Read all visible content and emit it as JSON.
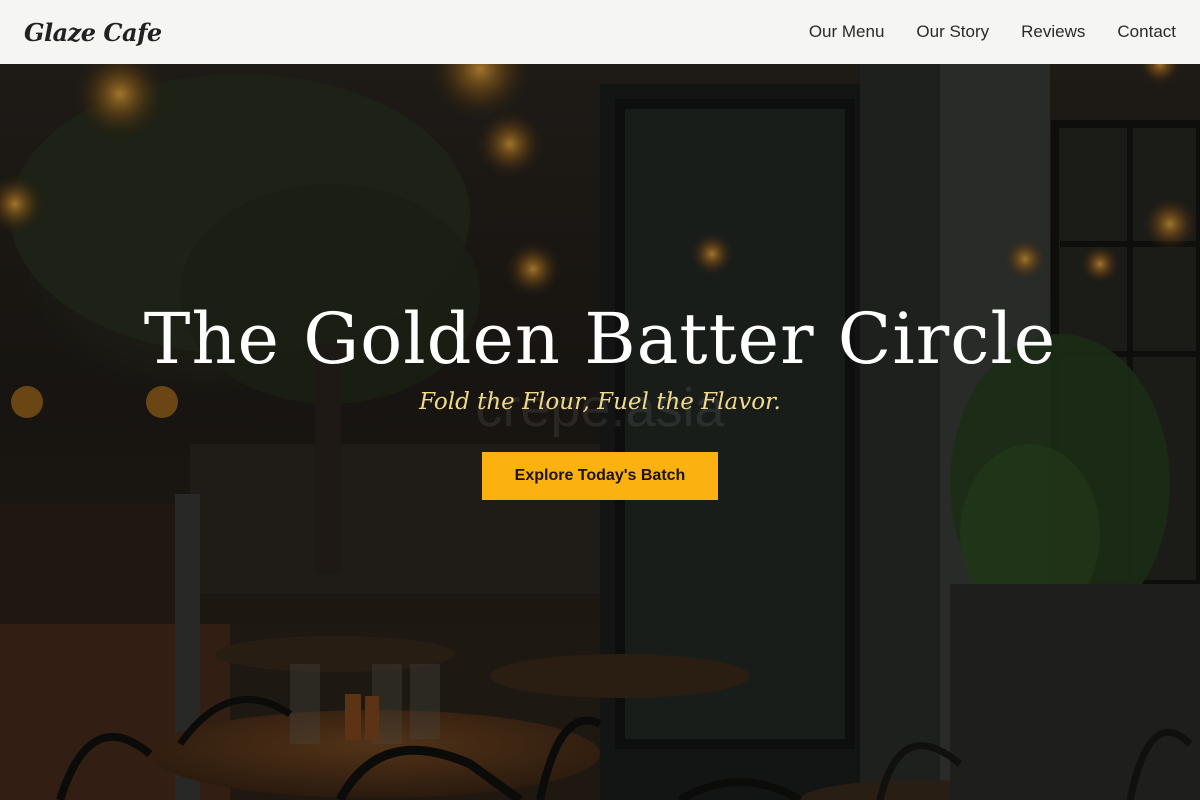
{
  "brand": {
    "name": "Glaze Cafe"
  },
  "nav": {
    "items": [
      {
        "label": "Our Menu"
      },
      {
        "label": "Our Story"
      },
      {
        "label": "Reviews"
      },
      {
        "label": "Contact"
      }
    ]
  },
  "hero": {
    "title": "The Golden Batter Circle",
    "subtitle": "Fold the Flour, Fuel the Flavor.",
    "cta_label": "Explore Today's Batch",
    "background_sign": "crepe.asia"
  },
  "colors": {
    "header_bg": "#f5f5f4",
    "accent": "#fbb210",
    "subtitle": "#f3d98a",
    "title": "#ffffff"
  }
}
